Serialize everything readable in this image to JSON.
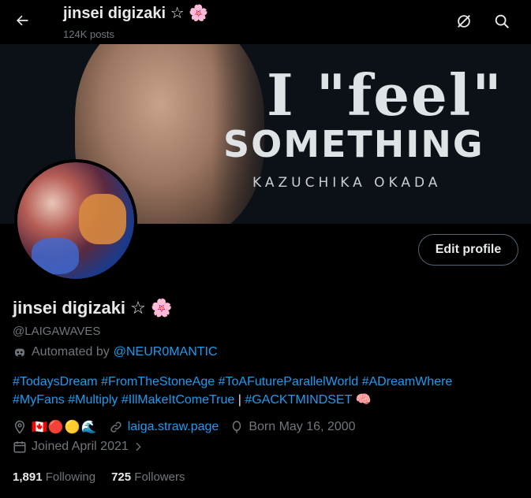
{
  "header": {
    "title": "jinsei digizaki ☆ 🌸",
    "posts_count": "124K posts"
  },
  "banner": {
    "line1": "I \"feel\"",
    "line2": "SOMETHING",
    "line3": "KAZUCHIKA OKADA"
  },
  "profile": {
    "edit_label": "Edit profile",
    "name": "jinsei digizaki ☆ 🌸",
    "handle": "@LAIGAWAVES",
    "automated_prefix": "Automated by",
    "automated_by": "@NEUR0MANTIC",
    "bio_tags": [
      "#TodaysDream",
      "#FromTheStoneAge",
      "#ToAFutureParallelWorld",
      "#ADreamWhere",
      "#MyFans",
      "#Multiply",
      "#IllMakeItComeTrue"
    ],
    "bio_separator": "|",
    "bio_last_tag": "#GACKTMINDSET",
    "bio_emoji": "🧠",
    "location_emojis": "🇨🇦🔴🟡🌊",
    "website": "laiga.straw.page",
    "born": "Born May 16, 2000",
    "joined": "Joined April 2021",
    "following_count": "1,891",
    "following_label": "Following",
    "followers_count": "725",
    "followers_label": "Followers"
  },
  "colors": {
    "accent": "#1d9bf0",
    "muted": "#71767b",
    "text": "#e7e9ea",
    "background": "#000000"
  },
  "icons": [
    "back-arrow-icon",
    "no-sync-icon",
    "search-icon",
    "robot-icon",
    "location-icon",
    "link-icon",
    "balloon-icon",
    "calendar-icon",
    "chevron-right-icon"
  ]
}
